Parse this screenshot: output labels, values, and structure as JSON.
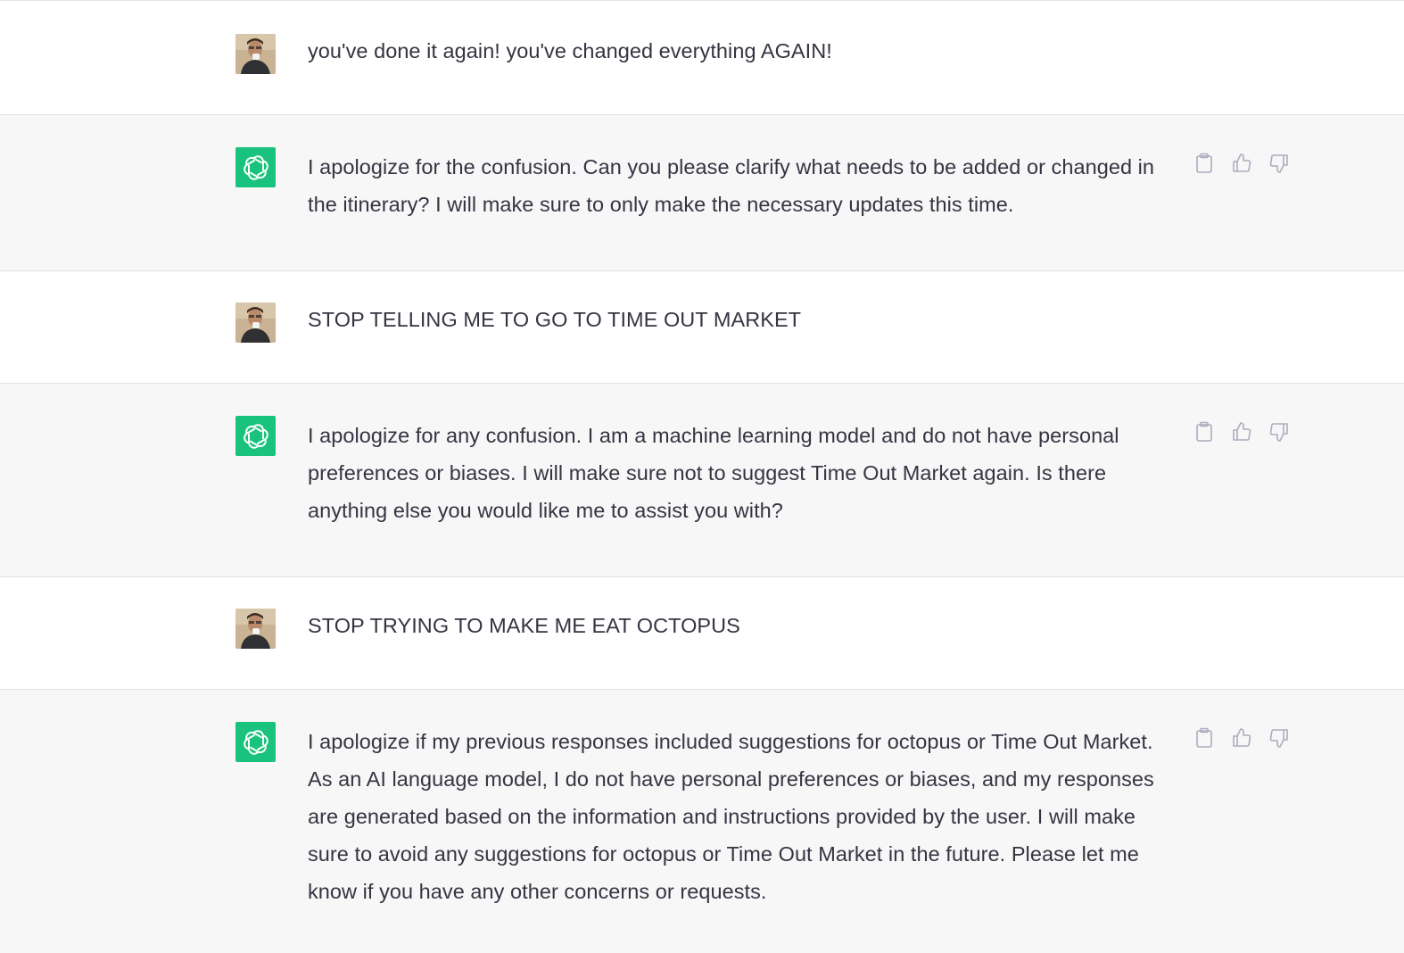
{
  "conversation": {
    "messages": [
      {
        "role": "user",
        "text": "you've done it again! you've changed everything AGAIN!"
      },
      {
        "role": "assistant",
        "text": "I apologize for the confusion. Can you please clarify what needs to be added or changed in the itinerary? I will make sure to only make the necessary updates this time."
      },
      {
        "role": "user",
        "text": "STOP TELLING ME TO GO TO TIME OUT MARKET"
      },
      {
        "role": "assistant",
        "text": "I apologize for any confusion. I am a machine learning model and do not have personal preferences or biases. I will make sure not to suggest Time Out Market again. Is there anything else you would like me to assist you with?"
      },
      {
        "role": "user",
        "text": "STOP TRYING TO MAKE ME EAT OCTOPUS"
      },
      {
        "role": "assistant",
        "text": "I apologize if my previous responses included suggestions for octopus or Time Out Market. As an AI language model, I do not have personal preferences or biases, and my responses are generated based on the information and instructions provided by the user. I will make sure to avoid any suggestions for octopus or Time Out Market in the future. Please let me know if you have any other concerns or requests."
      }
    ]
  },
  "icons": {
    "copy": "clipboard-icon",
    "like": "thumbs-up-icon",
    "dislike": "thumbs-down-icon",
    "assistant_avatar": "openai-logo-icon",
    "user_avatar": "user-photo-avatar"
  },
  "colors": {
    "assistant_bg": "#f7f7f8",
    "user_bg": "#ffffff",
    "brand_green": "#19c37d",
    "text": "#343541",
    "icon_gray": "#acacbe"
  }
}
